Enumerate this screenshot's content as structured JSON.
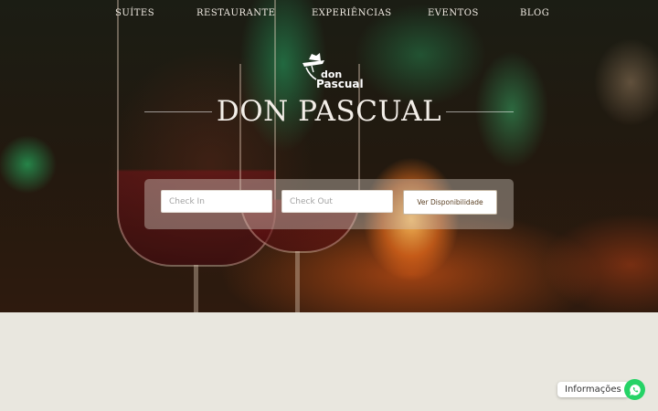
{
  "nav": {
    "items": [
      {
        "label": "SUÍTES"
      },
      {
        "label": "RESTAURANTE"
      },
      {
        "label": "EXPERIÊNCIAS"
      },
      {
        "label": "EVENTOS"
      },
      {
        "label": "BLOG"
      }
    ]
  },
  "logo": {
    "line1": "don",
    "line2": "Pascual"
  },
  "hero": {
    "title": "DON PASCUAL"
  },
  "booking": {
    "check_in_placeholder": "Check In",
    "check_out_placeholder": "Check Out",
    "button_label": "Ver Disponibilidade"
  },
  "chat": {
    "label": "Informações"
  },
  "colors": {
    "whatsapp": "#25d366",
    "page_bg": "#e9e7df",
    "button_text": "#5a3f22"
  }
}
